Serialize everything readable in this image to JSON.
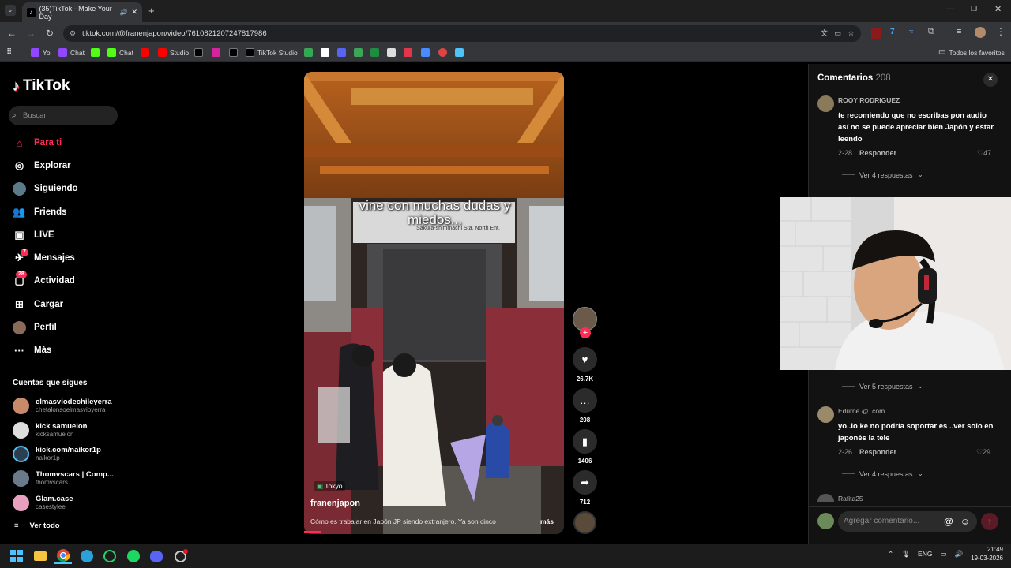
{
  "browser": {
    "tab_title": "(35)TikTok - Make Your Day",
    "url": "tiktok.com/@franenjapon/video/7610821207247817986",
    "bookmarks": [
      "Yo",
      "Chat",
      "Chat",
      "Studio",
      "TikTok Studio"
    ],
    "all_bookmarks": "Todos los favoritos"
  },
  "sidebar": {
    "logo": "TikTok",
    "search_placeholder": "Buscar",
    "nav": [
      {
        "label": "Para ti",
        "icon": "home-icon",
        "active": true
      },
      {
        "label": "Explorar",
        "icon": "compass-icon"
      },
      {
        "label": "Siguiendo",
        "icon": "following-avatar-icon"
      },
      {
        "label": "Friends",
        "icon": "friends-icon"
      },
      {
        "label": "LIVE",
        "icon": "live-icon"
      },
      {
        "label": "Mensajes",
        "icon": "message-icon",
        "badge": "7"
      },
      {
        "label": "Actividad",
        "icon": "activity-icon",
        "badge": "28"
      },
      {
        "label": "Cargar",
        "icon": "upload-icon"
      },
      {
        "label": "Perfil",
        "icon": "profile-avatar-icon"
      },
      {
        "label": "Más",
        "icon": "more-dots-icon"
      }
    ],
    "following_header": "Cuentas que sigues",
    "following": [
      {
        "name": "elmasviodechileyerra",
        "handle": "chetalonsoelmasvioyerra"
      },
      {
        "name": "kick samuelon",
        "handle": "kicksamuelon"
      },
      {
        "name": "kick.com/naikor1p",
        "handle": "naikor1p"
      },
      {
        "name": "Thomvscars | Comp...",
        "handle": "thomvscars"
      },
      {
        "name": "Glam.case",
        "handle": "casestylee"
      }
    ],
    "see_all": "Ver todo"
  },
  "video": {
    "overlay_text": "vine con muchas dudas y miedos...",
    "sign_text": "Sakura-shimmachi Sta. North Ent.",
    "location": "Tokyo",
    "username": "franenjapon",
    "description": "Cómo es trabajar en Japón JP siendo extranjero. Ya son cinco",
    "more": "más",
    "likes": "26.7K",
    "comments": "208",
    "saves": "1406",
    "shares": "712"
  },
  "comments": {
    "title": "Comentarios",
    "count": "208",
    "input_placeholder": "Agregar comentario...",
    "reply_label": "Responder",
    "items": [
      {
        "user": "ROOY RODRIGUEZ",
        "text": "te recomiendo que no escribas pon audio así no se puede apreciar bien Japón y estar leendo",
        "date": "2-28",
        "likes": "47",
        "replies": "Ver 4 respuestas"
      },
      {
        "user": "",
        "text": "",
        "date": "",
        "likes": "",
        "replies": "Ver 5 respuestas"
      },
      {
        "user": "Edurne @. com",
        "text": "yo..lo ke no podría soportar es ..ver solo en japonés la tele",
        "date": "2-26",
        "likes": "29",
        "replies": "Ver 4 respuestas"
      },
      {
        "user": "Rafita25",
        "text": "",
        "date": "",
        "likes": "",
        "replies": ""
      }
    ]
  },
  "taskbar": {
    "lang": "ENG",
    "time": "21:49",
    "date": "19-03-2026"
  }
}
